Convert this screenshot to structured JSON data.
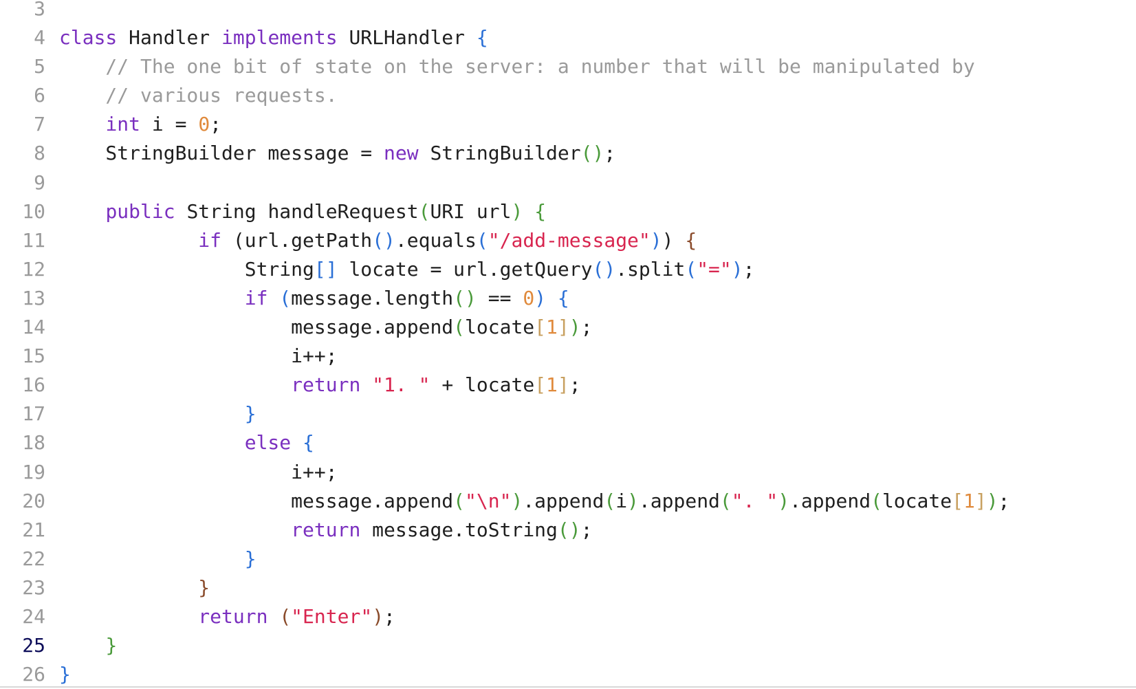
{
  "editor": {
    "language": "java",
    "active_line": 25,
    "lines": [
      {
        "n": "3",
        "tokens": []
      },
      {
        "n": "4",
        "tokens": [
          {
            "t": "class",
            "c": "kw"
          },
          {
            "t": " Handler ",
            "c": ""
          },
          {
            "t": "implements",
            "c": "kw"
          },
          {
            "t": " URLHandler ",
            "c": ""
          },
          {
            "t": "{",
            "c": "pl1"
          }
        ]
      },
      {
        "n": "5",
        "tokens": [
          {
            "t": "    // The one bit of state on the server: a number that will be manipulated by",
            "c": "com"
          }
        ]
      },
      {
        "n": "6",
        "tokens": [
          {
            "t": "    // various requests.",
            "c": "com"
          }
        ]
      },
      {
        "n": "7",
        "tokens": [
          {
            "t": "    ",
            "c": ""
          },
          {
            "t": "int",
            "c": "kw"
          },
          {
            "t": " i = ",
            "c": ""
          },
          {
            "t": "0",
            "c": "num"
          },
          {
            "t": ";",
            "c": ""
          }
        ]
      },
      {
        "n": "8",
        "tokens": [
          {
            "t": "    StringBuilder message = ",
            "c": ""
          },
          {
            "t": "new",
            "c": "kw"
          },
          {
            "t": " StringBuilder",
            "c": ""
          },
          {
            "t": "()",
            "c": "pl2"
          },
          {
            "t": ";",
            "c": ""
          }
        ]
      },
      {
        "n": "9",
        "tokens": []
      },
      {
        "n": "10",
        "tokens": [
          {
            "t": "    ",
            "c": ""
          },
          {
            "t": "public",
            "c": "kw"
          },
          {
            "t": " String handleRequest",
            "c": ""
          },
          {
            "t": "(",
            "c": "pl2"
          },
          {
            "t": "URI url",
            "c": ""
          },
          {
            "t": ")",
            "c": "pl2"
          },
          {
            "t": " ",
            "c": ""
          },
          {
            "t": "{",
            "c": "pl2"
          }
        ]
      },
      {
        "n": "11",
        "tokens": [
          {
            "t": "            ",
            "c": ""
          },
          {
            "t": "if",
            "c": "kw"
          },
          {
            "t": " (url.getPath",
            "c": ""
          },
          {
            "t": "()",
            "c": "pl1"
          },
          {
            "t": ".equals",
            "c": ""
          },
          {
            "t": "(",
            "c": "pl1"
          },
          {
            "t": "\"/add-message\"",
            "c": "str"
          },
          {
            "t": ")",
            "c": "pl1"
          },
          {
            "t": ")",
            "c": ""
          },
          {
            "t": " ",
            "c": ""
          },
          {
            "t": "{",
            "c": "pl3"
          }
        ]
      },
      {
        "n": "12",
        "tokens": [
          {
            "t": "                String",
            "c": ""
          },
          {
            "t": "[]",
            "c": "pl1"
          },
          {
            "t": " locate = url.getQuery",
            "c": ""
          },
          {
            "t": "()",
            "c": "pl1"
          },
          {
            "t": ".split",
            "c": ""
          },
          {
            "t": "(",
            "c": "pl1"
          },
          {
            "t": "\"=\"",
            "c": "str"
          },
          {
            "t": ")",
            "c": "pl1"
          },
          {
            "t": ";",
            "c": ""
          }
        ]
      },
      {
        "n": "13",
        "tokens": [
          {
            "t": "                ",
            "c": ""
          },
          {
            "t": "if",
            "c": "kw"
          },
          {
            "t": " ",
            "c": ""
          },
          {
            "t": "(",
            "c": "pl1"
          },
          {
            "t": "message.length",
            "c": ""
          },
          {
            "t": "()",
            "c": "pl2"
          },
          {
            "t": " == ",
            "c": ""
          },
          {
            "t": "0",
            "c": "num"
          },
          {
            "t": ")",
            "c": "pl1"
          },
          {
            "t": " ",
            "c": ""
          },
          {
            "t": "{",
            "c": "pl1"
          }
        ]
      },
      {
        "n": "14",
        "tokens": [
          {
            "t": "                    message.append",
            "c": ""
          },
          {
            "t": "(",
            "c": "pl2"
          },
          {
            "t": "locate",
            "c": ""
          },
          {
            "t": "[",
            "c": "hl"
          },
          {
            "t": "1",
            "c": "num"
          },
          {
            "t": "]",
            "c": "hl"
          },
          {
            "t": ")",
            "c": "pl2"
          },
          {
            "t": ";",
            "c": ""
          }
        ]
      },
      {
        "n": "15",
        "tokens": [
          {
            "t": "                    i++;",
            "c": ""
          }
        ]
      },
      {
        "n": "16",
        "tokens": [
          {
            "t": "                    ",
            "c": ""
          },
          {
            "t": "return",
            "c": "kw"
          },
          {
            "t": " ",
            "c": ""
          },
          {
            "t": "\"1. \"",
            "c": "str"
          },
          {
            "t": " + locate",
            "c": ""
          },
          {
            "t": "[",
            "c": "hl"
          },
          {
            "t": "1",
            "c": "num"
          },
          {
            "t": "]",
            "c": "hl"
          },
          {
            "t": ";",
            "c": ""
          }
        ]
      },
      {
        "n": "17",
        "tokens": [
          {
            "t": "                ",
            "c": ""
          },
          {
            "t": "}",
            "c": "pl1"
          }
        ]
      },
      {
        "n": "18",
        "tokens": [
          {
            "t": "                ",
            "c": ""
          },
          {
            "t": "else",
            "c": "kw"
          },
          {
            "t": " ",
            "c": ""
          },
          {
            "t": "{",
            "c": "pl1"
          }
        ]
      },
      {
        "n": "19",
        "tokens": [
          {
            "t": "                    i++;",
            "c": ""
          }
        ]
      },
      {
        "n": "20",
        "tokens": [
          {
            "t": "                    message.append",
            "c": ""
          },
          {
            "t": "(",
            "c": "pl2"
          },
          {
            "t": "\"\\n\"",
            "c": "str"
          },
          {
            "t": ")",
            "c": "pl2"
          },
          {
            "t": ".append",
            "c": ""
          },
          {
            "t": "(",
            "c": "pl2"
          },
          {
            "t": "i",
            "c": ""
          },
          {
            "t": ")",
            "c": "pl2"
          },
          {
            "t": ".append",
            "c": ""
          },
          {
            "t": "(",
            "c": "pl2"
          },
          {
            "t": "\". \"",
            "c": "str"
          },
          {
            "t": ")",
            "c": "pl2"
          },
          {
            "t": ".append",
            "c": ""
          },
          {
            "t": "(",
            "c": "pl2"
          },
          {
            "t": "locate",
            "c": ""
          },
          {
            "t": "[",
            "c": "hl"
          },
          {
            "t": "1",
            "c": "num"
          },
          {
            "t": "]",
            "c": "hl"
          },
          {
            "t": ")",
            "c": "pl2"
          },
          {
            "t": ";",
            "c": ""
          }
        ]
      },
      {
        "n": "21",
        "tokens": [
          {
            "t": "                    ",
            "c": ""
          },
          {
            "t": "return",
            "c": "kw"
          },
          {
            "t": " message.toString",
            "c": ""
          },
          {
            "t": "()",
            "c": "pl2"
          },
          {
            "t": ";",
            "c": ""
          }
        ]
      },
      {
        "n": "22",
        "tokens": [
          {
            "t": "                ",
            "c": ""
          },
          {
            "t": "}",
            "c": "pl1"
          }
        ]
      },
      {
        "n": "23",
        "tokens": [
          {
            "t": "            ",
            "c": ""
          },
          {
            "t": "}",
            "c": "pl3"
          }
        ]
      },
      {
        "n": "24",
        "tokens": [
          {
            "t": "            ",
            "c": ""
          },
          {
            "t": "return",
            "c": "kw"
          },
          {
            "t": " ",
            "c": ""
          },
          {
            "t": "(",
            "c": "pl3"
          },
          {
            "t": "\"Enter\"",
            "c": "str"
          },
          {
            "t": ")",
            "c": "pl3"
          },
          {
            "t": ";",
            "c": ""
          }
        ]
      },
      {
        "n": "25",
        "tokens": [
          {
            "t": "    ",
            "c": ""
          },
          {
            "t": "}",
            "c": "pl2"
          }
        ]
      },
      {
        "n": "26",
        "tokens": [
          {
            "t": "}",
            "c": "pl1"
          }
        ]
      }
    ]
  },
  "colors": {
    "keyword": "#7a2fbf",
    "string": "#d8254f",
    "number": "#e08a3c",
    "comment": "#9a9a9a",
    "paren_blue": "#2a6fd6",
    "paren_green": "#4a9a3a",
    "paren_brown": "#8a4b2b",
    "bracket_gold": "#c8a060",
    "line_number": "#9a9a9a",
    "active_line_number": "#0e0e5a"
  }
}
